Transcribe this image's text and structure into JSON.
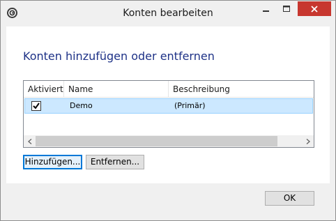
{
  "window": {
    "title": "Konten bearbeiten"
  },
  "heading": "Konten hinzufügen oder entfernen",
  "list": {
    "columns": [
      "Aktiviert",
      "Name",
      "Beschreibung"
    ],
    "rows": [
      {
        "enabled": true,
        "name": "Demo",
        "description": "(Primär)"
      }
    ]
  },
  "buttons": {
    "add": "Hinzufügen...",
    "remove": "Entfernen...",
    "ok": "OK"
  },
  "colors": {
    "accent": "#1e3287",
    "selection": "#cce8ff",
    "close": "#c7372f"
  },
  "icons": {
    "app": "mail-app-icon",
    "minimize": "minimize-icon",
    "maximize": "maximize-icon",
    "close": "close-icon",
    "check": "checkmark-icon",
    "scroll_left": "chevron-left-icon",
    "scroll_right": "chevron-right-icon"
  }
}
